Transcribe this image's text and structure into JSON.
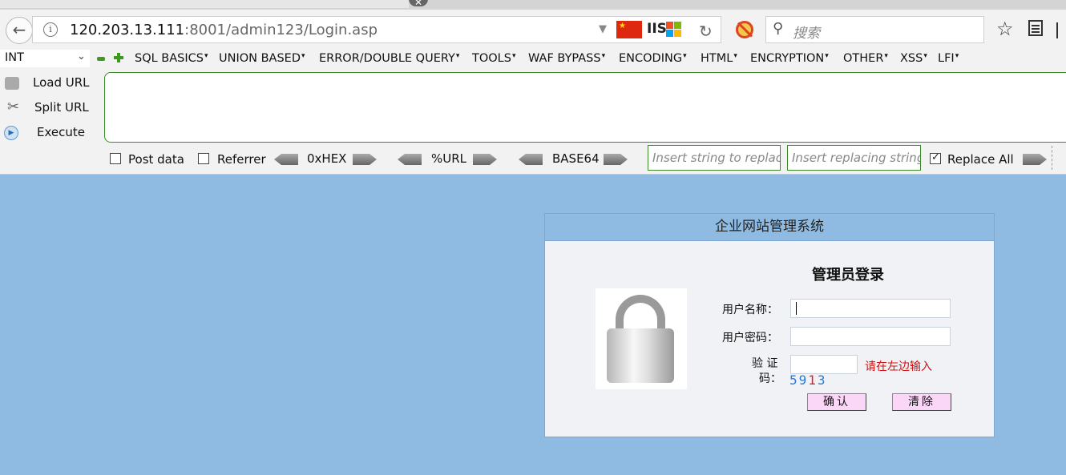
{
  "browser": {
    "tab_close_glyph": "✕",
    "url_host": "120.203.13.111",
    "url_rest": ":8001/admin123/Login.asp",
    "server_badge": "IIS",
    "search_placeholder": "搜索"
  },
  "hackbar": {
    "injection_type": "INT",
    "menus": [
      "SQL BASICS",
      "UNION BASED",
      "ERROR/DOUBLE QUERY",
      "TOOLS",
      "WAF BYPASS",
      "ENCODING",
      "HTML",
      "ENCRYPTION",
      "OTHER",
      "XSS",
      "LFI"
    ],
    "load_url": "Load URL",
    "split_url": "Split URL",
    "execute": "Execute",
    "post_data": "Post data",
    "referrer": "Referrer",
    "hex": "0xHEX",
    "url_enc": "%URL",
    "base64": "BASE64",
    "replace_from_placeholder": "Insert string to replace",
    "replace_to_placeholder": "Insert replacing string",
    "replace_all": "Replace All",
    "post_data_checked": false,
    "referrer_checked": false,
    "replace_all_checked": true
  },
  "login": {
    "header": "企业网站管理系统",
    "title": "管理员登录",
    "username_label": "用户名称：",
    "password_label": "用户密码：",
    "captcha_label_1": "验 证",
    "captcha_label_2": "码：",
    "captcha_hint": "请在左边输入",
    "captcha_code_a": "59",
    "captcha_code_b": "1",
    "captcha_code_c": "3",
    "confirm_button": "确认",
    "clear_button": "清除"
  }
}
